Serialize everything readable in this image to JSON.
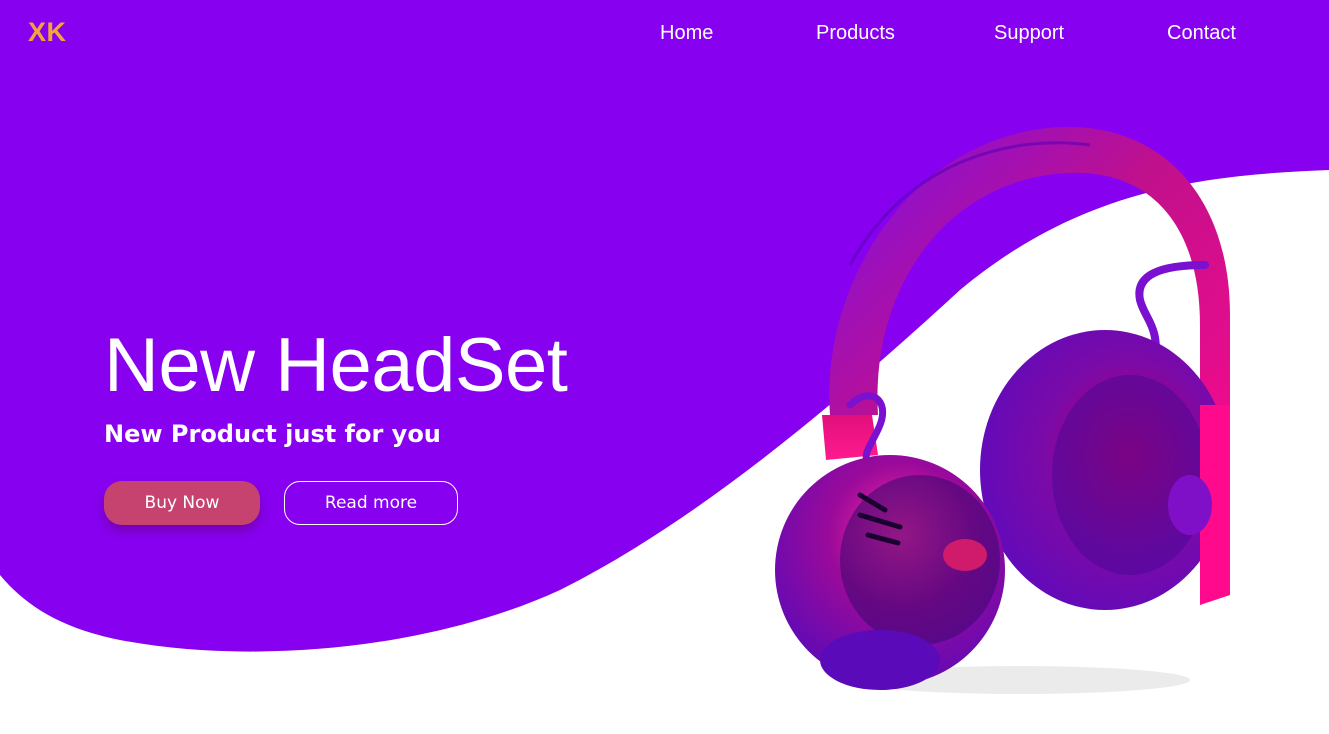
{
  "brand": {
    "logo_text": "XK"
  },
  "nav": {
    "items": [
      {
        "label": "Home"
      },
      {
        "label": "Products"
      },
      {
        "label": "Support"
      },
      {
        "label": "Contact"
      }
    ]
  },
  "hero": {
    "title": "New HeadSet",
    "subtitle": "New Product just for you",
    "buy_label": "Buy Now",
    "read_label": "Read more"
  },
  "product_image": {
    "icon": "headphones-illustration"
  },
  "colors": {
    "primary_purple": "#8700f0",
    "logo_orange": "#f0a53a",
    "buy_button": "#c7436f",
    "product_pink": "#ff0a8c",
    "background": "#ffffff"
  }
}
